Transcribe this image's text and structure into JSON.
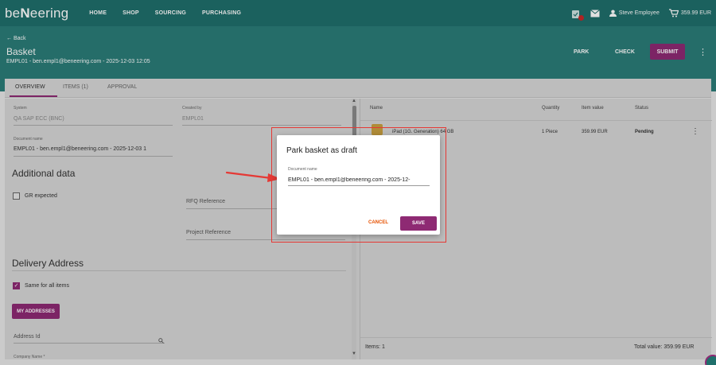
{
  "app": {
    "logo_prefix": "be",
    "logo_n": "N",
    "logo_suffix": "eering"
  },
  "nav": {
    "home": "HOME",
    "shop": "SHOP",
    "sourcing": "SOURCING",
    "purchasing": "PURCHASING"
  },
  "topright": {
    "user": "Steve Employee",
    "cart_total": "359.99 EUR"
  },
  "header": {
    "back": "Back",
    "title": "Basket",
    "subtitle": "EMPL01 - ben.empl1@beneering.com - 2025-12-03 12:05",
    "park": "PARK",
    "check": "CHECK",
    "submit": "SUBMIT"
  },
  "tabs": {
    "overview": "OVERVIEW",
    "items": "ITEMS (1)",
    "approval": "APPROVAL"
  },
  "form": {
    "system_label": "System",
    "system_value": "QA SAP ECC (BNC)",
    "created_by_label": "Created by",
    "created_by_value": "EMPL01",
    "doc_name_label": "Document name",
    "doc_name_value": "EMPL01 - ben.empl1@beneering.com - 2025-12-03 1",
    "additional_title": "Additional data",
    "gr_expected": "GR expected",
    "rfq_reference": "RFQ Reference",
    "project_reference": "Project Reference",
    "delivery_title": "Delivery Address",
    "same_for_all": "Same for all items",
    "my_addresses": "MY ADDRESSES",
    "address_id": "Address Id",
    "company_name": "Company Name *"
  },
  "table": {
    "headers": {
      "name": "Name",
      "quantity": "Quantity",
      "item_value": "Item value",
      "status": "Status"
    },
    "rows": [
      {
        "name": "iPad (1G. Generation) 64 GB",
        "quantity": "1 Piece",
        "value": "359.99 EUR",
        "status": "Pending"
      }
    ],
    "items_count": "Items: 1",
    "total": "Total value:  359.99 EUR"
  },
  "dialog": {
    "title": "Park basket as draft",
    "doc_label": "Document name",
    "doc_value": "EMPL01 - ben.empl1@beneering.com - 2025-12-",
    "cancel": "CANCEL",
    "save": "SAVE"
  },
  "colors": {
    "primary": "#2b7d78",
    "accent": "#8e2a73",
    "highlight": "#e53935"
  }
}
